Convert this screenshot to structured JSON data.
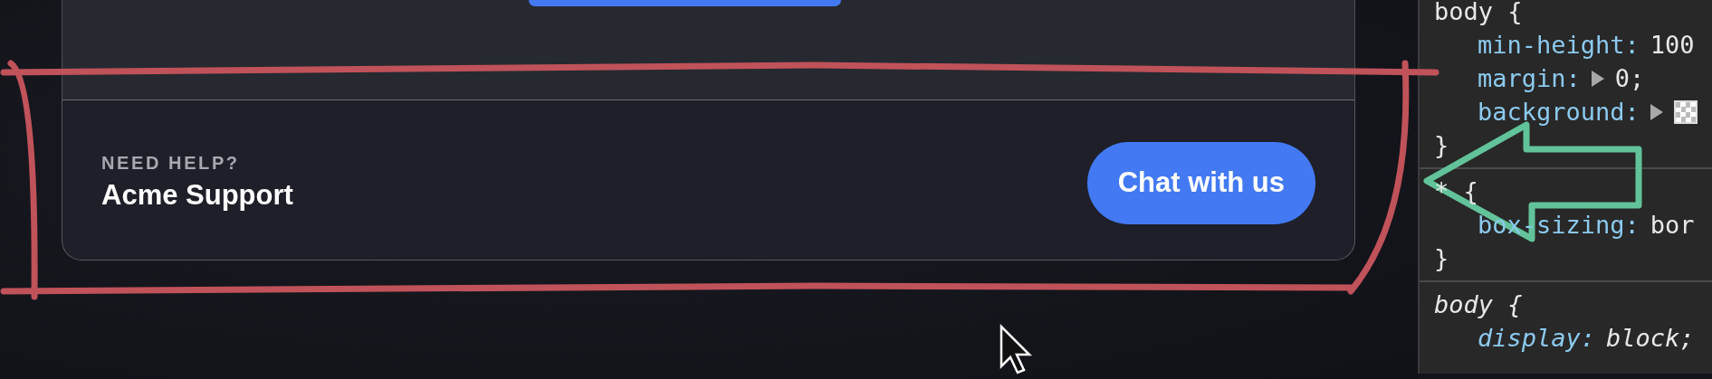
{
  "card": {
    "footer": {
      "eyebrow": "NEED HELP?",
      "title": "Acme Support",
      "button": "Chat with us"
    }
  },
  "styles_panel": {
    "rules": [
      {
        "kind": "author",
        "selector": "body {",
        "close": "}",
        "declarations": [
          {
            "kind": "plain",
            "property": "min-height:",
            "value": "100"
          },
          {
            "kind": "expandable",
            "property": "margin:",
            "value": "0;"
          },
          {
            "kind": "color",
            "property": "background:"
          }
        ]
      },
      {
        "kind": "author",
        "selector": "* {",
        "close": "}",
        "declarations": [
          {
            "kind": "plain",
            "property": "box-sizing:",
            "value": "bor"
          }
        ]
      },
      {
        "kind": "user-agent",
        "selector": "body {",
        "declarations": [
          {
            "kind": "plain",
            "property": "display:",
            "value": "block;"
          }
        ]
      }
    ]
  }
}
